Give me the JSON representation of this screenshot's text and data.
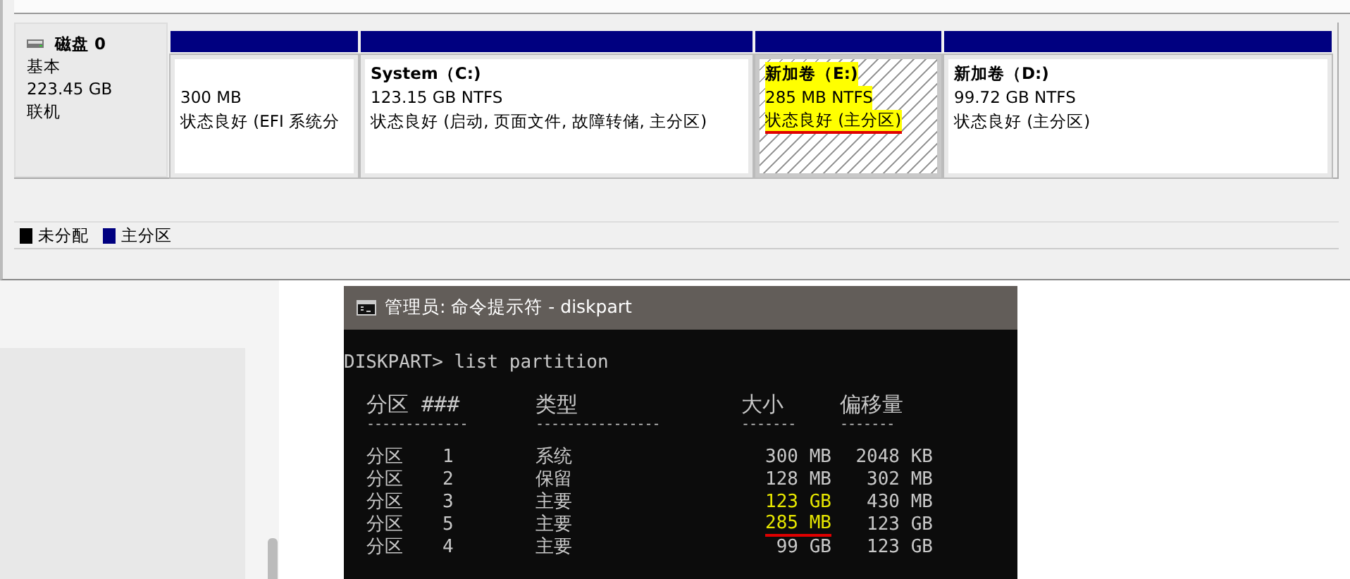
{
  "disk": {
    "name": "磁盘 0",
    "type": "基本",
    "size": "223.45 GB",
    "state": "联机"
  },
  "partitions": [
    {
      "size": "300 MB",
      "status": "状态良好 (EFI 系统分",
      "selected": false,
      "highlighted": false,
      "underlined": false
    },
    {
      "name": "System（C:)",
      "size": "123.15 GB NTFS",
      "status": "状态良好 (启动, 页面文件, 故障转储, 主分区)",
      "selected": false,
      "highlighted": false,
      "underlined": false
    },
    {
      "name": "新加卷（E:)",
      "size": "285 MB NTFS",
      "status": "状态良好 (主分区)",
      "selected": true,
      "highlighted": true,
      "underlined": true
    },
    {
      "name": "新加卷（D:)",
      "size": "99.72 GB NTFS",
      "status": "状态良好 (主分区)",
      "selected": false,
      "highlighted": false,
      "underlined": false
    }
  ],
  "legend": [
    {
      "label": "未分配",
      "color": "#000000"
    },
    {
      "label": "主分区",
      "color": "#000080"
    }
  ],
  "console": {
    "title": "管理员: 命令提示符 - diskpart",
    "command": "DISKPART> list partition",
    "columns": [
      {
        "label": "分区 ###",
        "rule": "-------------"
      },
      {
        "label": "类型",
        "rule": "----------------"
      },
      {
        "label": "大小",
        "rule": "-------"
      },
      {
        "label": "偏移量",
        "rule": "-------"
      }
    ],
    "rows": [
      {
        "name": "分区",
        "number": "1",
        "type": "系统",
        "size": "300 MB",
        "offset": "2048 KB",
        "highlighted": false,
        "underlined": false
      },
      {
        "name": "分区",
        "number": "2",
        "type": "保留",
        "size": "128 MB",
        "offset": "302 MB",
        "highlighted": false,
        "underlined": false
      },
      {
        "name": "分区",
        "number": "3",
        "type": "主要",
        "size": "123 GB",
        "offset": "430 MB",
        "highlighted": true,
        "underlined": false
      },
      {
        "name": "分区",
        "number": "5",
        "type": "主要",
        "size": "285 MB",
        "offset": "123 GB",
        "highlighted": true,
        "underlined": true
      },
      {
        "name": "分区",
        "number": "4",
        "type": "主要",
        "size": "99 GB",
        "offset": "123 GB",
        "highlighted": false,
        "underlined": false
      }
    ]
  }
}
